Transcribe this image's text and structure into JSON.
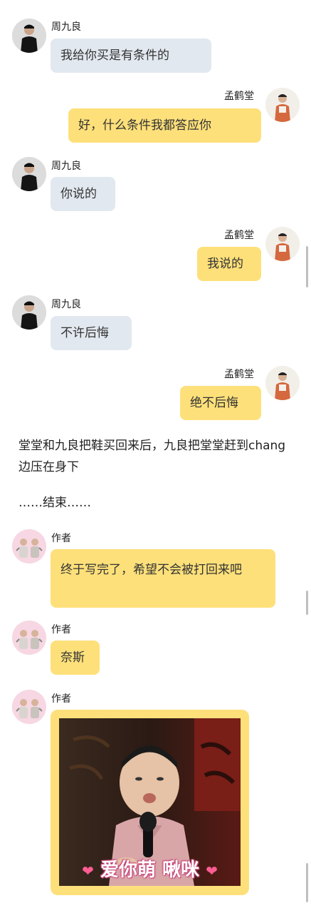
{
  "messages": [
    {
      "sender": "周九良",
      "text": "我给你买是有条件的"
    },
    {
      "sender": "孟鹤堂",
      "text": "好，什么条件我都答应你"
    },
    {
      "sender": "周九良",
      "text": "你说的"
    },
    {
      "sender": "孟鹤堂",
      "text": "我说的"
    },
    {
      "sender": "周九良",
      "text": "不许后悔"
    },
    {
      "sender": "孟鹤堂",
      "text": "绝不后悔"
    }
  ],
  "narration": {
    "story": "堂堂和九良把鞋买回来后，九良把堂堂赶到chang边压在身下",
    "ending": "……结束……"
  },
  "author_messages": [
    {
      "sender": "作者",
      "text": "终于写完了，希望不会被打回来吧"
    },
    {
      "sender": "作者",
      "text": "奈斯"
    },
    {
      "sender": "作者",
      "sticker_caption": "爱你萌 啾咪"
    }
  ],
  "colors": {
    "left_bubble": "#e2e8ef",
    "right_bubble": "#fde07a",
    "author_bubble": "#fde07a"
  }
}
